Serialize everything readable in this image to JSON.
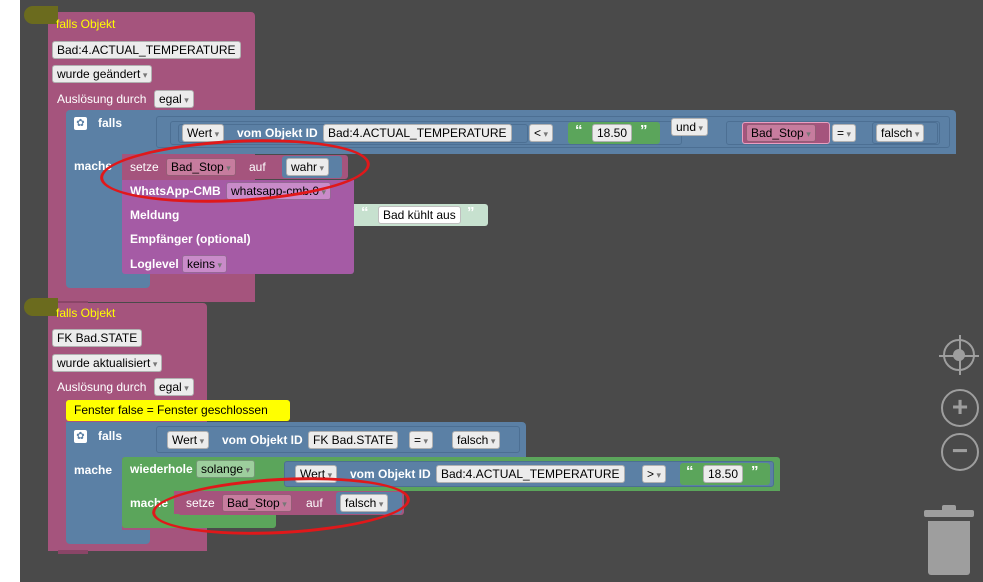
{
  "event1": {
    "title": "falls Objekt",
    "object_id": "Bad:4.ACTUAL_TEMPERATURE",
    "trigger_type": "wurde geändert",
    "trigger_label": "Auslösung durch",
    "trigger_value": "egal",
    "if_label": "falls",
    "do_label": "mache",
    "cond1": {
      "prop": "Wert",
      "from_label": "vom Objekt ID",
      "obj": "Bad:4.ACTUAL_TEMPERATURE",
      "op": "<",
      "value": "18.50"
    },
    "logic_op": "und",
    "cond2": {
      "var": "Bad_Stop",
      "op": "=",
      "value": "falsch"
    },
    "set_label": "setze",
    "set_var": "Bad_Stop",
    "set_to_label": "auf",
    "set_value": "wahr",
    "whatsapp": {
      "label": "WhatsApp-CMB",
      "instance": "whatsapp-cmb.0",
      "msg_label": "Meldung",
      "msg_value": "Bad kühlt aus",
      "recipient_label": "Empfänger (optional)",
      "loglevel_label": "Loglevel",
      "loglevel_value": "keins"
    }
  },
  "event2": {
    "title": "falls Objekt",
    "object_id": "FK Bad.STATE",
    "trigger_type": "wurde aktualisiert",
    "trigger_label": "Auslösung durch",
    "trigger_value": "egal",
    "comment": "Fenster false = Fenster geschlossen",
    "if_label": "falls",
    "do_label": "mache",
    "cond": {
      "prop": "Wert",
      "from_label": "vom Objekt ID",
      "obj": "FK Bad.STATE",
      "op": "=",
      "value": "falsch"
    },
    "loop_label": "wiederhole",
    "loop_mode": "solange",
    "loop_cond": {
      "prop": "Wert",
      "from_label": "vom Objekt ID",
      "obj": "Bad:4.ACTUAL_TEMPERATURE",
      "op": ">",
      "value": "18.50"
    },
    "loop_do_label": "mache",
    "set_label": "setze",
    "set_var": "Bad_Stop",
    "set_to_label": "auf",
    "set_value": "falsch"
  },
  "quote_open": "“",
  "quote_close": "”",
  "controls": {
    "center_icon": "crosshair-icon",
    "zoom_in_icon": "plus-icon",
    "zoom_out_icon": "minus-icon",
    "trash_icon": "trash-icon"
  }
}
